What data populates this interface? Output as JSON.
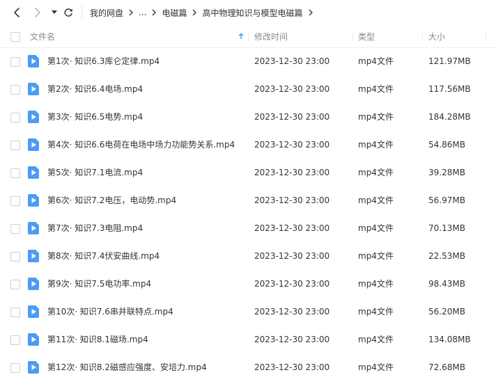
{
  "nav": {
    "back_icon": "chevron-left-icon",
    "forward_icon": "chevron-right-icon",
    "history_icon": "caret-down-icon",
    "refresh_icon": "refresh-icon"
  },
  "breadcrumb": {
    "root": "我的网盘",
    "ellipsis": "...",
    "parent": "电磁篇",
    "current": "高中物理知识与模型电磁篇"
  },
  "table": {
    "headers": {
      "name": "文件名",
      "modified": "修改时间",
      "type": "类型",
      "size": "大小"
    },
    "sort_icon": "arrow-up-icon",
    "rows": [
      {
        "name": "第1次· 知识6.3库仑定律.mp4",
        "modified": "2023-12-30 23:00",
        "type": "mp4文件",
        "size": "121.97MB"
      },
      {
        "name": "第2次· 知识6.4电场.mp4",
        "modified": "2023-12-30 23:00",
        "type": "mp4文件",
        "size": "117.56MB"
      },
      {
        "name": "第3次· 知识6.5电势.mp4",
        "modified": "2023-12-30 23:00",
        "type": "mp4文件",
        "size": "184.28MB"
      },
      {
        "name": "第4次· 知识6.6电荷在电场中场力功能势关系.mp4",
        "modified": "2023-12-30 23:00",
        "type": "mp4文件",
        "size": "54.86MB"
      },
      {
        "name": "第5次· 知识7.1电流.mp4",
        "modified": "2023-12-30 23:00",
        "type": "mp4文件",
        "size": "39.28MB"
      },
      {
        "name": "第6次· 知识7.2电压，电动势.mp4",
        "modified": "2023-12-30 23:00",
        "type": "mp4文件",
        "size": "56.97MB"
      },
      {
        "name": "第7次· 知识7.3电阻.mp4",
        "modified": "2023-12-30 23:00",
        "type": "mp4文件",
        "size": "70.13MB"
      },
      {
        "name": "第8次· 知识7.4伏安曲线.mp4",
        "modified": "2023-12-30 23:00",
        "type": "mp4文件",
        "size": "22.53MB"
      },
      {
        "name": "第9次· 知识7.5电功率.mp4",
        "modified": "2023-12-30 23:00",
        "type": "mp4文件",
        "size": "98.43MB"
      },
      {
        "name": "第10次· 知识7.6串并联特点.mp4",
        "modified": "2023-12-30 23:00",
        "type": "mp4文件",
        "size": "56.20MB"
      },
      {
        "name": "第11次· 知识8.1磁场.mp4",
        "modified": "2023-12-30 23:00",
        "type": "mp4文件",
        "size": "134.08MB"
      },
      {
        "name": "第12次· 知识8.2磁感应强度、安培力.mp4",
        "modified": "2023-12-30 23:00",
        "type": "mp4文件",
        "size": "72.68MB"
      }
    ]
  },
  "colors": {
    "accent": "#4a9cf5",
    "icon_bg": "#4a9cf5",
    "header_text": "#888888",
    "row_text": "#333333"
  }
}
